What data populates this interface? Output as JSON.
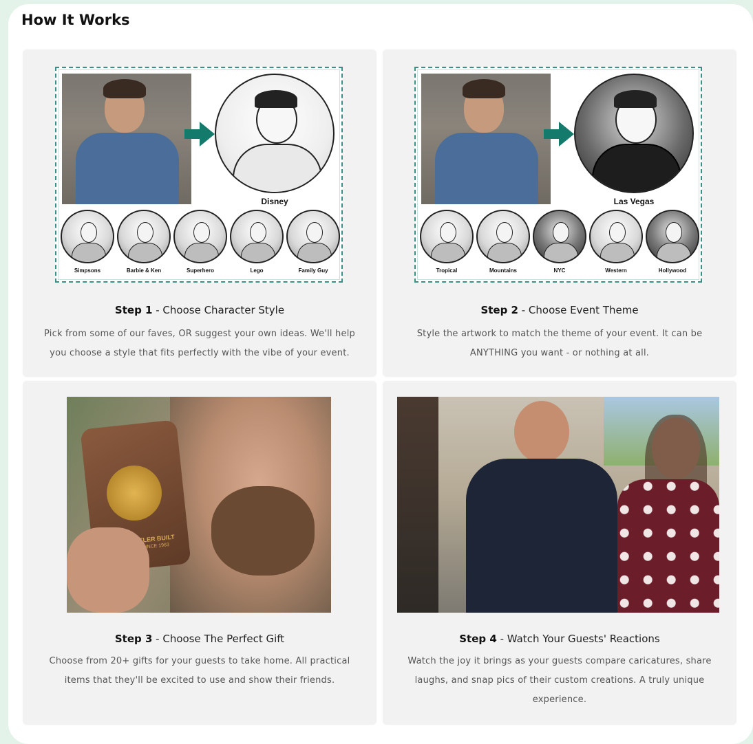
{
  "section": {
    "title": "How It Works"
  },
  "steps": [
    {
      "number": "Step 1",
      "title": " - Choose Character Style",
      "description": "Pick from some of our faves, OR suggest your own ideas. We'll help you choose a style that fits perfectly with the vibe of your event.",
      "featured_label": "Disney",
      "thumb_labels": [
        "Simpsons",
        "Barbie & Ken",
        "Superhero",
        "Lego",
        "Family Guy"
      ]
    },
    {
      "number": "Step 2",
      "title": " - Choose Event Theme",
      "description": "Style the artwork to match the theme of your event. It can be ANYTHING you want - or nothing at all.",
      "featured_label": "Las Vegas",
      "thumb_labels": [
        "Tropical",
        "Mountains",
        "NYC",
        "Western",
        "Hollywood"
      ]
    },
    {
      "number": "Step 3",
      "title": " - Choose The Perfect Gift",
      "description": "Choose from 20+ gifts for your guests to take home. All practical items that they'll be excited to use and show their friends.",
      "product_logo": "BUTLER BUILT",
      "product_logo_sub": "SINCE 1963"
    },
    {
      "number": "Step 4",
      "title": " - Watch Your Guests' Reactions",
      "description": "Watch the joy it brings as your guests compare caricatures, share laughs, and snap pics of their custom creations. A truly unique experience."
    }
  ],
  "colors": {
    "page_bg": "#e3f3ea",
    "card_bg": "#f2f2f2",
    "arrow": "#137a6c",
    "border": "#3b8f85"
  }
}
